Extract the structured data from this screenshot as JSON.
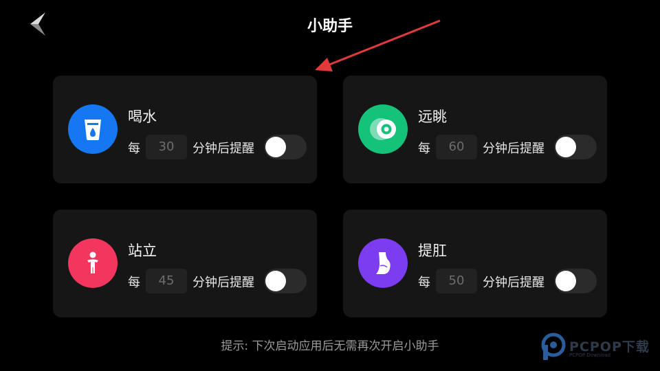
{
  "header": {
    "title": "小助手"
  },
  "cards": [
    {
      "title": "喝水",
      "every_label": "每",
      "minutes": "30",
      "suffix": "分钟后提醒",
      "enabled": false,
      "icon": "water-glass-icon",
      "color": "#1677f2"
    },
    {
      "title": "远眺",
      "every_label": "每",
      "minutes": "60",
      "suffix": "分钟后提醒",
      "enabled": false,
      "icon": "eye-icon",
      "color": "#14c27a"
    },
    {
      "title": "站立",
      "every_label": "每",
      "minutes": "45",
      "suffix": "分钟后提醒",
      "enabled": false,
      "icon": "standing-person-icon",
      "color": "#f2365e"
    },
    {
      "title": "提肛",
      "every_label": "每",
      "minutes": "50",
      "suffix": "分钟后提醒",
      "enabled": false,
      "icon": "body-silhouette-icon",
      "color": "#7c3cf0"
    }
  ],
  "hint": "提示: 下次启动应用后无需再次开启小助手",
  "watermark": {
    "text": "PCPOP下载",
    "subtext": "PCPOP Download"
  },
  "colors": {
    "background": "#000000",
    "card": "#161616",
    "annotation_arrow": "#e03a3a"
  }
}
